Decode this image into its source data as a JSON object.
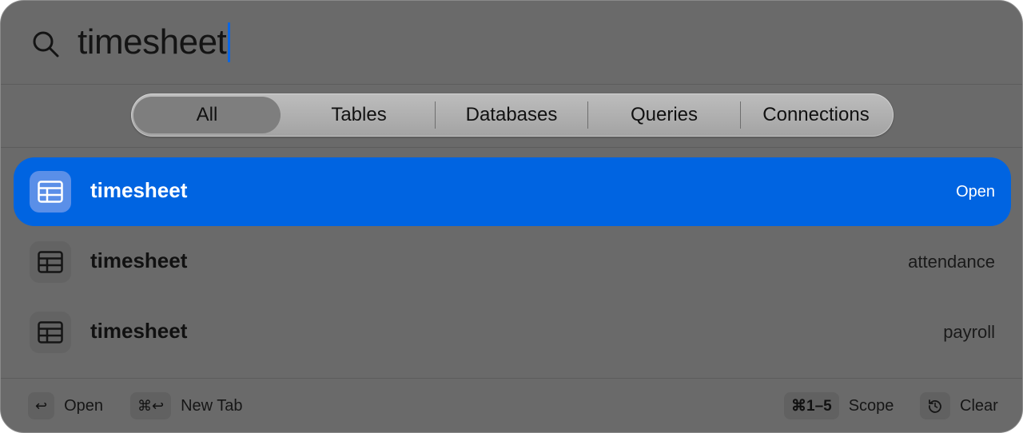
{
  "search": {
    "query": "timesheet"
  },
  "scopes": [
    {
      "label": "All",
      "active": true
    },
    {
      "label": "Tables",
      "active": false
    },
    {
      "label": "Databases",
      "active": false
    },
    {
      "label": "Queries",
      "active": false
    },
    {
      "label": "Connections",
      "active": false
    }
  ],
  "results": [
    {
      "title": "timesheet",
      "meta": "Open",
      "icon": "table-icon",
      "selected": true
    },
    {
      "title": "timesheet",
      "meta": "attendance",
      "icon": "table-icon",
      "selected": false
    },
    {
      "title": "timesheet",
      "meta": "payroll",
      "icon": "table-icon",
      "selected": false
    }
  ],
  "footer": {
    "open": {
      "key": "↩",
      "label": "Open"
    },
    "new_tab": {
      "key": "⌘↩",
      "label": "New Tab"
    },
    "scope": {
      "key": "⌘1–5",
      "label": "Scope"
    },
    "clear": {
      "key_icon": "clear-history-icon",
      "label": "Clear"
    }
  },
  "colors": {
    "accent": "#0064e1",
    "panel": "#6a6a6a",
    "caret": "#0a66e4"
  }
}
